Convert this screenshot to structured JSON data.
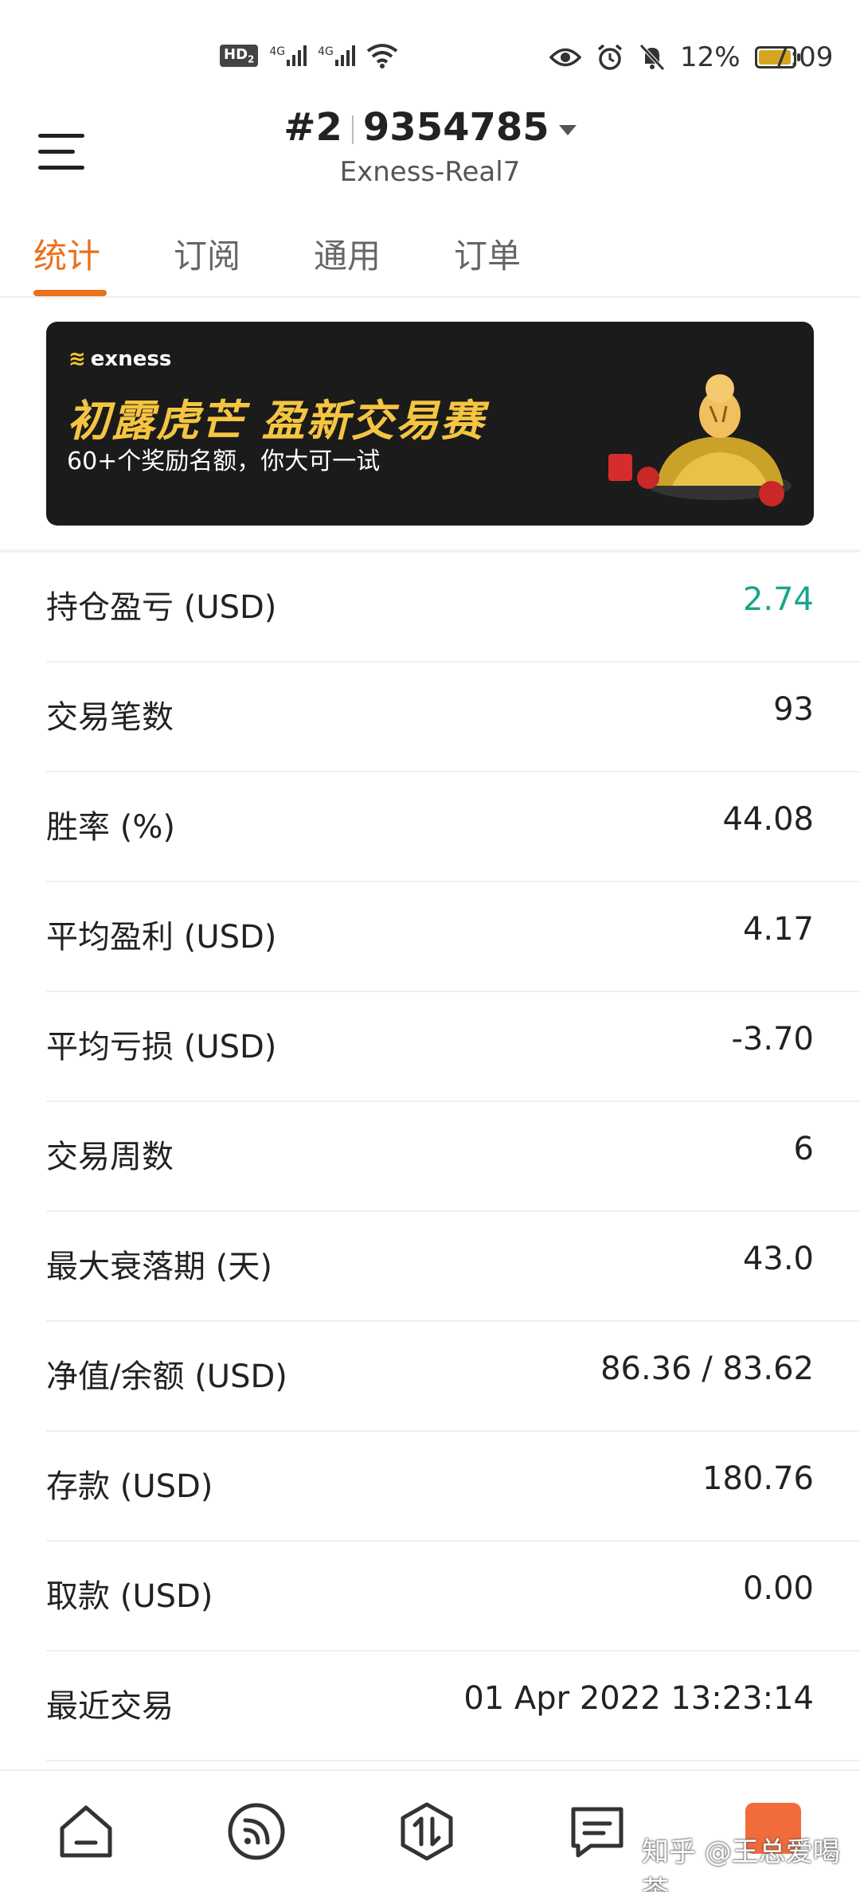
{
  "status_bar": {
    "hd": "HD",
    "hd_sub": "2",
    "net1": "4G",
    "net2": "4G",
    "battery_percent": "12%",
    "time": "7:09"
  },
  "header": {
    "account_prefix": "#2",
    "account_number": "9354785",
    "server": "Exness-Real7"
  },
  "tabs": [
    {
      "label": "统计",
      "active": true
    },
    {
      "label": "订阅",
      "active": false
    },
    {
      "label": "通用",
      "active": false
    },
    {
      "label": "订单",
      "active": false
    }
  ],
  "banner": {
    "logo": "exness",
    "title": "初露虎芒 盈新交易赛",
    "subtitle": "60+个奖励名额，你大可一试"
  },
  "stats": [
    {
      "label": "持仓盈亏 (USD)",
      "value": "2.74",
      "color": "#18a58a"
    },
    {
      "label": "交易笔数",
      "value": "93"
    },
    {
      "label": "胜率 (%)",
      "value": "44.08"
    },
    {
      "label": "平均盈利 (USD)",
      "value": "4.17"
    },
    {
      "label": "平均亏损 (USD)",
      "value": "-3.70"
    },
    {
      "label": "交易周数",
      "value": "6"
    },
    {
      "label": "最大衰落期 (天)",
      "value": "43.0"
    },
    {
      "label": "净值/余额 (USD)",
      "value": "86.36 / 83.62"
    },
    {
      "label": "存款 (USD)",
      "value": "180.76"
    },
    {
      "label": "取款 (USD)",
      "value": "0.00"
    },
    {
      "label": "最近交易",
      "value": "01 Apr 2022 13:23:14"
    }
  ],
  "bottom_nav": {
    "items": [
      "home-icon",
      "feed-icon",
      "trade-icon",
      "chat-icon"
    ],
    "watermark": "知乎 @王总爱喝茶"
  },
  "colors": {
    "accent": "#e8711a",
    "positive": "#18a58a"
  }
}
